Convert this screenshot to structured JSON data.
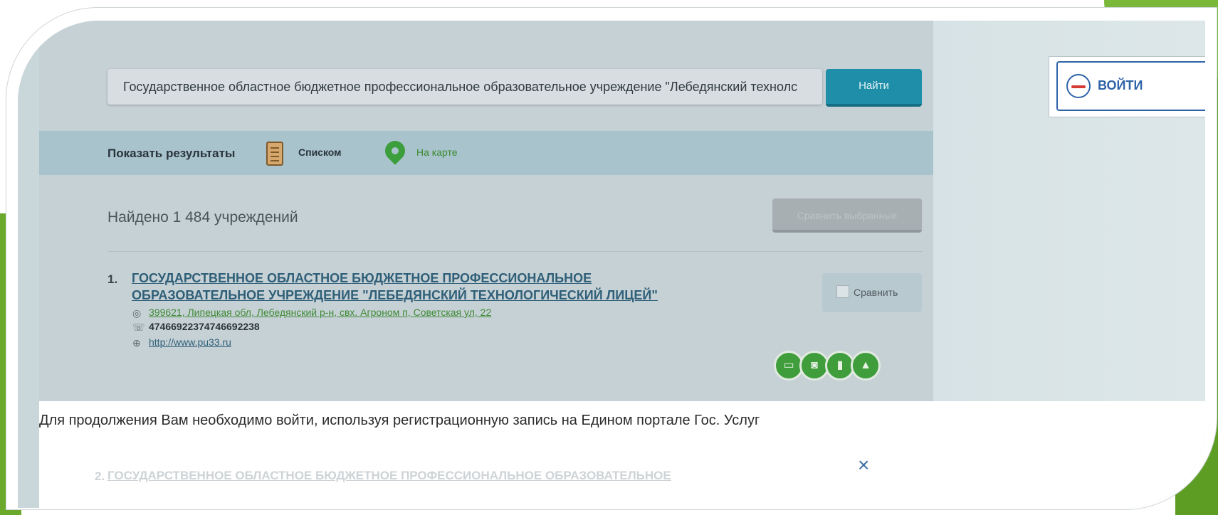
{
  "search": {
    "value": "Государственное областное бюджетное профессиональное образовательное учреждение \"Лебедянский технолс",
    "button": "Найти"
  },
  "view": {
    "label": "Показать результаты",
    "list": "Списком",
    "map": "На карте"
  },
  "results": {
    "found": "Найдено 1 484 учреждений",
    "compare_selected": "Сравнить выбранные"
  },
  "institution": {
    "number": "1.",
    "name": "ГОСУДАРСТВЕННОЕ ОБЛАСТНОЕ БЮДЖЕТНОЕ ПРОФЕССИОНАЛЬНОЕ ОБРАЗОВАТЕЛЬНОЕ УЧРЕЖДЕНИЕ \"ЛЕБЕДЯНСКИЙ ТЕХНОЛОГИЧЕСКИЙ ЛИЦЕЙ\"",
    "address": "399621, Липецкая обл, Лебедянский р-н, свх. Агроном п, Советская ул, 22",
    "phone": "47466922374746692238",
    "website": "http://www.pu33.ru",
    "compare": "Сравнить"
  },
  "next_item": {
    "number": "2.",
    "name": "ГОСУДАРСТВЕННОЕ ОБЛАСТНОЕ БЮДЖЕТНОЕ ПРОФЕССИОНАЛЬНОЕ ОБРАЗОВАТЕЛЬНОЕ"
  },
  "banner": {
    "message": "Для продолжения Вам необходимо войти, используя регистрационную запись на Едином портале Гос. Услуг",
    "close": "×"
  },
  "login": {
    "label": "ВОЙТИ"
  },
  "icons": {
    "services": [
      "boarding-icon",
      "cafeteria-icon",
      "uniform-icon",
      "like-icon"
    ]
  },
  "colors": {
    "accent": "#1f8ea8",
    "link": "#2f5f78",
    "green": "#3f9d3c",
    "login": "#2f63a8"
  }
}
